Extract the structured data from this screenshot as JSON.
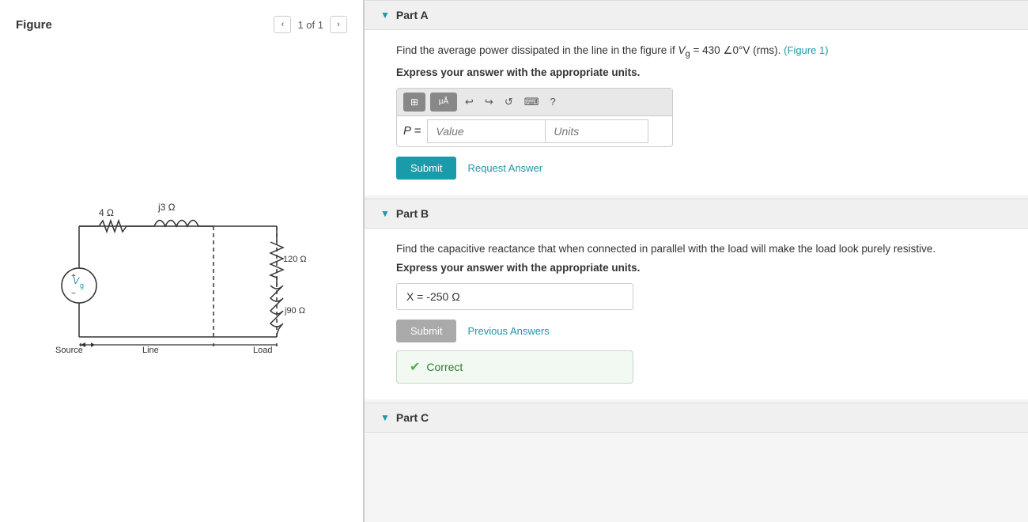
{
  "left": {
    "figure_label": "Figure",
    "figure_nav": "1 of 1"
  },
  "partA": {
    "header": "Part A",
    "problem_text_prefix": "Find the average power dissipated in the line in the figure if ",
    "math_var": "V",
    "math_sub": "g",
    "math_eq": " = 430 ∠0°V (rms). ",
    "figure_link": "(Figure 1)",
    "express_text": "Express your answer with the appropriate units.",
    "p_label": "P =",
    "value_placeholder": "Value",
    "units_placeholder": "Units",
    "submit_label": "Submit",
    "request_label": "Request Answer"
  },
  "partB": {
    "header": "Part B",
    "problem_text": "Find the capacitive reactance that when connected in parallel with the load will make the load look purely resistive.",
    "express_text": "Express your answer with the appropriate units.",
    "answer_value": "X =  -250 Ω",
    "submit_label": "Submit",
    "prev_answers_label": "Previous Answers",
    "correct_label": "Correct"
  },
  "partC": {
    "header": "Part C"
  },
  "toolbar": {
    "icon1": "⊞",
    "icon2": "μÅ",
    "icon3": "↩",
    "icon4": "↪",
    "icon5": "↺",
    "icon6": "⌨",
    "icon7": "?"
  }
}
